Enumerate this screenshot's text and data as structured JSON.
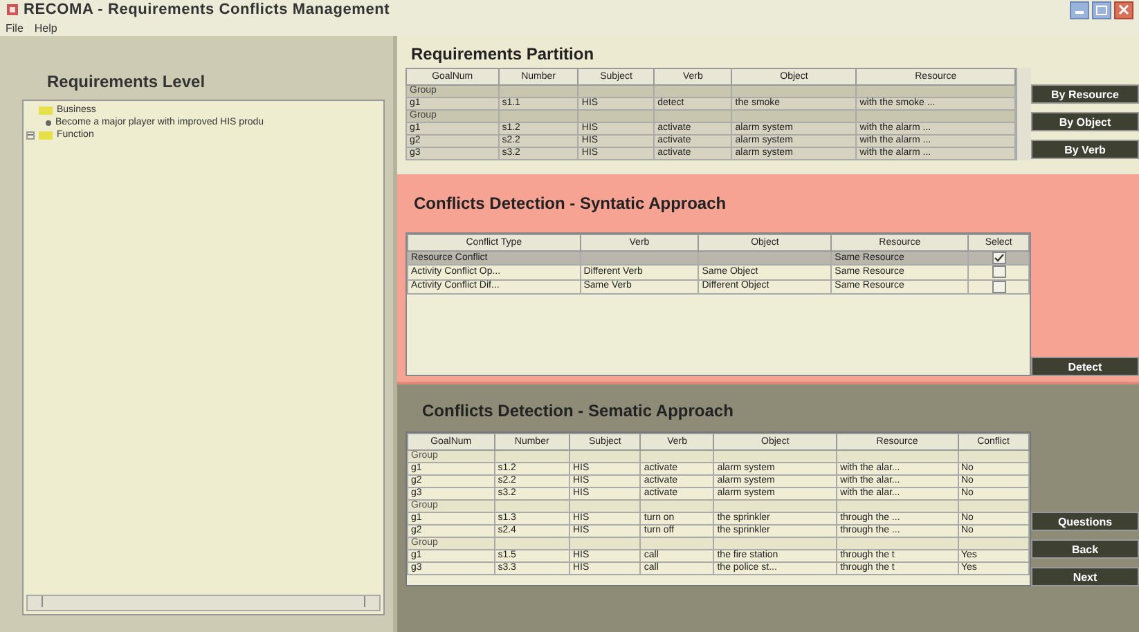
{
  "window": {
    "title": "RECOMA - Requirements Conflicts Management"
  },
  "menu": [
    "File",
    "Help"
  ],
  "requirements_level": {
    "title": "Requirements Level",
    "tree": [
      {
        "label": "Business",
        "expanded": true,
        "children": [
          {
            "label": "Become a major player with improved HIS produ"
          }
        ]
      },
      {
        "label": "Function",
        "expanded": false
      }
    ]
  },
  "partition": {
    "title": "Requirements Partition",
    "columns": [
      "GoalNum",
      "Number",
      "Subject",
      "Verb",
      "Object",
      "Resource"
    ],
    "rows": [
      {
        "kind": "group",
        "cells": [
          "Group",
          "",
          "",
          "",
          "",
          ""
        ]
      },
      {
        "kind": "item",
        "cells": [
          "g1",
          "s1.1",
          "HIS",
          "detect",
          "the smoke",
          "with the smoke ..."
        ]
      },
      {
        "kind": "group",
        "cells": [
          "Group",
          "",
          "",
          "",
          "",
          ""
        ]
      },
      {
        "kind": "item",
        "cells": [
          "g1",
          "s1.2",
          "HIS",
          "activate",
          "alarm system",
          "with the alarm ..."
        ]
      },
      {
        "kind": "item",
        "cells": [
          "g2",
          "s2.2",
          "HIS",
          "activate",
          "alarm system",
          "with the alarm ..."
        ]
      },
      {
        "kind": "item",
        "cells": [
          "g3",
          "s3.2",
          "HIS",
          "activate",
          "alarm system",
          "with the alarm ..."
        ]
      }
    ],
    "buttons": [
      "By Resource",
      "By Object",
      "By Verb"
    ]
  },
  "syntactic": {
    "title": "Conflicts Detection - Syntatic Approach",
    "columns": [
      "Conflict Type",
      "Verb",
      "Object",
      "Resource",
      "Select"
    ],
    "rows": [
      {
        "selected": true,
        "checked": true,
        "cells": [
          "Resource Conflict",
          "",
          "",
          "Same Resource"
        ]
      },
      {
        "selected": false,
        "checked": false,
        "cells": [
          "Activity Conflict Op...",
          "Different Verb",
          "Same Object",
          "Same Resource"
        ]
      },
      {
        "selected": false,
        "checked": false,
        "cells": [
          "Activity Conflict Dif...",
          "Same Verb",
          "Different Object",
          "Same Resource"
        ]
      }
    ],
    "button": "Detect"
  },
  "semantic": {
    "title": "Conflicts Detection - Sematic Approach",
    "columns": [
      "GoalNum",
      "Number",
      "Subject",
      "Verb",
      "Object",
      "Resource",
      "Conflict"
    ],
    "rows": [
      {
        "kind": "group",
        "cells": [
          "Group",
          "",
          "",
          "",
          "",
          "",
          ""
        ]
      },
      {
        "kind": "item",
        "cells": [
          "g1",
          "s1.2",
          "HIS",
          "activate",
          "alarm system",
          "with the alar...",
          "No"
        ]
      },
      {
        "kind": "item",
        "cells": [
          "g2",
          "s2.2",
          "HIS",
          "activate",
          "alarm system",
          "with the alar...",
          "No"
        ]
      },
      {
        "kind": "item",
        "cells": [
          "g3",
          "s3.2",
          "HIS",
          "activate",
          "alarm system",
          "with the alar...",
          "No"
        ]
      },
      {
        "kind": "group",
        "cells": [
          "Group",
          "",
          "",
          "",
          "",
          "",
          ""
        ]
      },
      {
        "kind": "item",
        "cells": [
          "g1",
          "s1.3",
          "HIS",
          "turn on",
          "the sprinkler",
          "through the ...",
          "No"
        ]
      },
      {
        "kind": "item",
        "cells": [
          "g2",
          "s2.4",
          "HIS",
          "turn off",
          "the sprinkler",
          "through the ...",
          "No"
        ]
      },
      {
        "kind": "group",
        "cells": [
          "Group",
          "",
          "",
          "",
          "",
          "",
          ""
        ]
      },
      {
        "kind": "item",
        "cells": [
          "g1",
          "s1.5",
          "HIS",
          "call",
          "the fire station",
          "through the t",
          "Yes"
        ]
      },
      {
        "kind": "item",
        "cells": [
          "g3",
          "s3.3",
          "HIS",
          "call",
          "the police st...",
          "through the t",
          "Yes"
        ]
      }
    ],
    "buttons": [
      "Questions",
      "Back",
      "Next"
    ]
  }
}
